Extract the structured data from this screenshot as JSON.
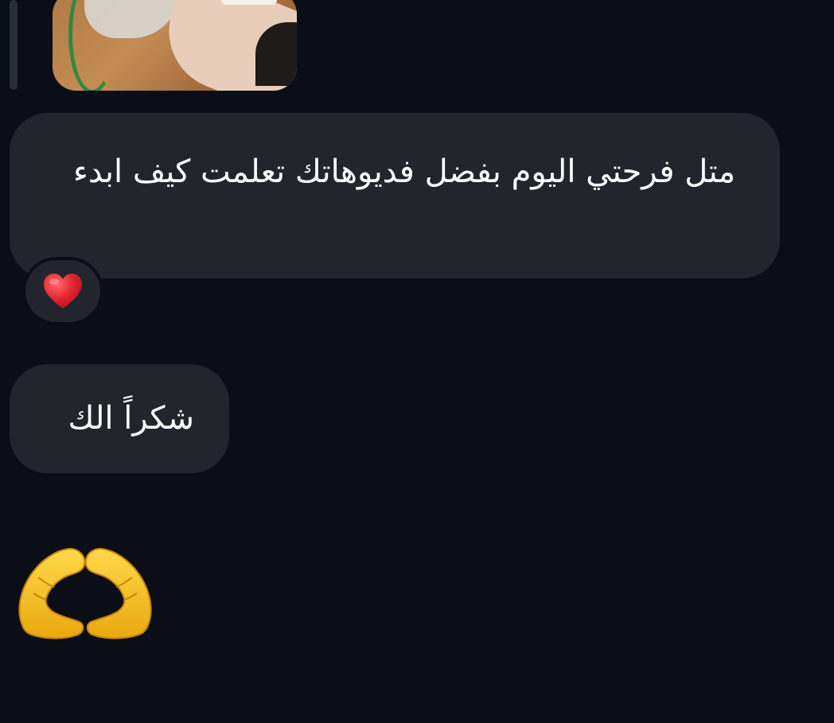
{
  "messages": [
    {
      "text": "متل فرحتي اليوم بفضل فديوهاتك تعلمت كيف ابدء",
      "reaction": "red-heart"
    },
    {
      "text": "شكراً الك"
    },
    {
      "emoji": "heart-hands"
    }
  ],
  "colors": {
    "background": "#0b0e16",
    "bubble": "#23252c",
    "text": "#ffffff",
    "heart": "#e0222e",
    "emoji_yellow": "#f6c425"
  }
}
